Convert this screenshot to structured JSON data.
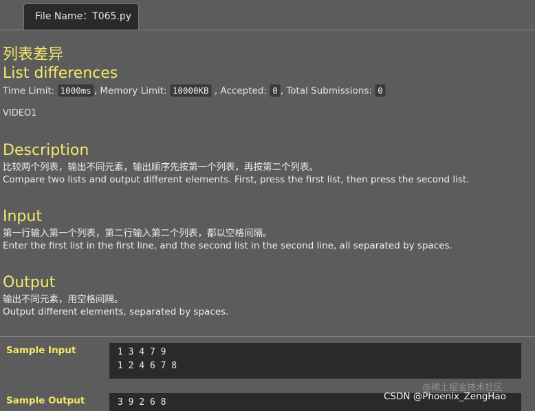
{
  "tab": {
    "label": "File Name：T065.py"
  },
  "problem": {
    "title_zh": "列表差异",
    "title_en": "List differences",
    "limits": {
      "time_label": "Time Limit:",
      "time_value": "1000ms",
      "memory_label": ", Memory Limit:",
      "memory_value": "10000KB",
      "accepted_label": ", Accepted:",
      "accepted_value": "0",
      "submissions_label": ", Total Submissions:",
      "submissions_value": "0"
    },
    "video": "VIDEO1"
  },
  "description": {
    "heading": "Description",
    "zh": "比较两个列表，输出不同元素，输出顺序先按第一个列表，再按第二个列表。",
    "en": "Compare two lists and output different elements. First, press the first list, then press the second list."
  },
  "input": {
    "heading": "Input",
    "zh": "第一行输入第一个列表，第二行输入第二个列表，都以空格间隔。",
    "en": "Enter the first list in the first line, and the second list in the second line, all separated by spaces."
  },
  "output": {
    "heading": "Output",
    "zh": "输出不同元素，用空格间隔。",
    "en": "Output different elements, separated by spaces."
  },
  "samples": {
    "input_label": "Sample Input",
    "input_lines": [
      "1 3 4 7 9",
      "1 2 4 6 7 8"
    ],
    "output_label": "Sample Output",
    "output_lines": [
      "3 9 2 6 8"
    ]
  },
  "watermark": {
    "main": "CSDN @Phoenix_ZengHao",
    "faint": "@稀土掘金技术社区"
  },
  "colors": {
    "background": "#5c5c5c",
    "heading_yellow": "#f4e96a",
    "code_box": "#2a2a2a",
    "tab_bg": "#2a2a2a"
  }
}
